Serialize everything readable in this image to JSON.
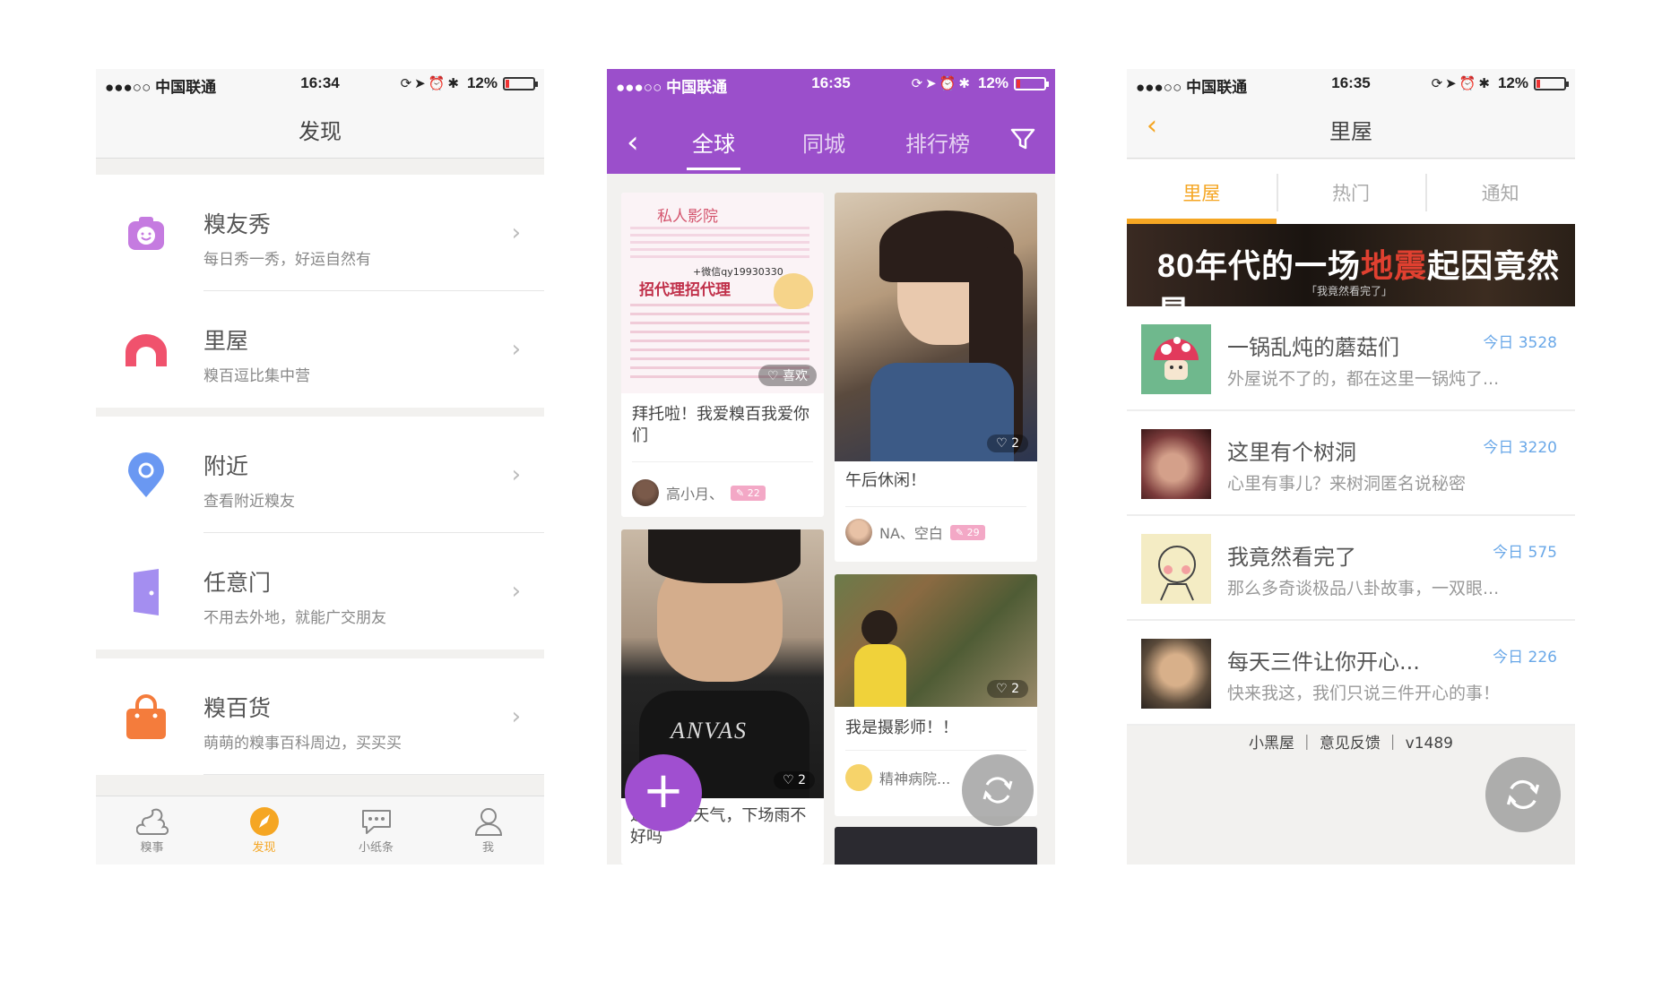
{
  "status": {
    "carrier": "●●●○○ 中国联通",
    "battery": "12%",
    "screens": [
      "16:34",
      "16:35",
      "16:35"
    ]
  },
  "screen1": {
    "title": "发现",
    "items": [
      {
        "name": "糗友秀",
        "desc": "每日秀一秀，好运自然有",
        "icon": "camera-icon",
        "color": "#c57be0"
      },
      {
        "name": "里屋",
        "desc": "糗百逗比集中营",
        "icon": "house-arch-icon",
        "color": "#f0526d"
      },
      {
        "name": "附近",
        "desc": "查看附近糗友",
        "icon": "location-pin-icon",
        "color": "#6a98f2"
      },
      {
        "name": "任意门",
        "desc": "不用去外地，就能广交朋友",
        "icon": "door-icon",
        "color": "#a48ef0"
      },
      {
        "name": "糗百货",
        "desc": "萌萌的糗事百科周边，买买买",
        "icon": "shopping-bag-icon",
        "color": "#f47c3c"
      }
    ],
    "tabs": [
      {
        "label": "糗事",
        "icon": "poop-icon"
      },
      {
        "label": "发现",
        "icon": "compass-icon"
      },
      {
        "label": "小纸条",
        "icon": "chat-bubble-icon"
      },
      {
        "label": "我",
        "icon": "person-icon"
      }
    ],
    "active_tab": "发现",
    "accent": "#f5a623"
  },
  "screen2": {
    "tabs": [
      "全球",
      "同城",
      "排行榜"
    ],
    "active_tab": "全球",
    "header_color": "#9b4fcb",
    "cards": [
      {
        "banner": {
          "shop": "私人影院",
          "line1": "+微信qy19930330",
          "line2": "招代理招代理",
          "like": "喜欢"
        },
        "caption": "拜托啦！我爱糗百我爱你们",
        "author": "高小月、",
        "likes": ""
      },
      {
        "caption": "午后休闲！",
        "author": "NA、空白",
        "likes": "2"
      },
      {
        "caption": "这",
        "caption_rest": "的天气，下场雨不好吗",
        "likes": "2"
      },
      {
        "caption": "我是摄影师！！",
        "author": "精神病院...",
        "likes": "2"
      }
    ]
  },
  "screen3": {
    "title": "里屋",
    "tabs": [
      "里屋",
      "热门",
      "通知"
    ],
    "active_tab": "里屋",
    "banner": {
      "pre": "80年代的一场",
      "red": "地震",
      "post": "起因竟然是...",
      "sub": "「我竟然看完了」"
    },
    "rows": [
      {
        "name": "一锅乱炖的蘑菇们",
        "count": "今日 3528",
        "desc": "外屋说不了的，都在这里一锅炖了..."
      },
      {
        "name": "这里有个树洞",
        "count": "今日 3220",
        "desc": "心里有事儿？来树洞匿名说秘密"
      },
      {
        "name": "我竟然看完了",
        "count": "今日 575",
        "desc": "那么多奇谈极品八卦故事，一双眼..."
      },
      {
        "name": "每天三件让你开心...",
        "count": "今日 226",
        "desc": "快来我这，我们只说三件开心的事！"
      }
    ],
    "footer": "小黑屋 ｜ 意见反馈 ｜ v1489"
  }
}
